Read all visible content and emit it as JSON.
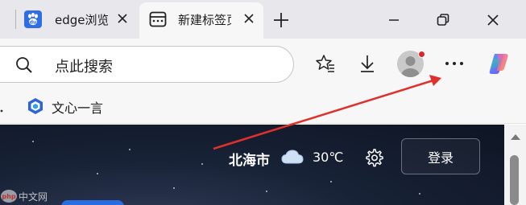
{
  "tabs": {
    "baidu_title": "edge浏览器",
    "active_title": "新建标签页"
  },
  "address_bar": {
    "placeholder": "点此搜索"
  },
  "favorites": {
    "items": [
      {
        "label": "文心一言",
        "icon": "wenxin-icon"
      }
    ]
  },
  "page": {
    "weather_city": "北海市",
    "weather_temp": "30℃",
    "weather_icon": "cloud-icon",
    "login_label": "登录"
  },
  "colors": {
    "tabstrip_bg": "#e8e8ec",
    "toolbar_bg": "#f7f7f7",
    "page_bg": "#182236",
    "annotation_arrow": "#e0302c",
    "avatar_notification": "#e0242b"
  }
}
